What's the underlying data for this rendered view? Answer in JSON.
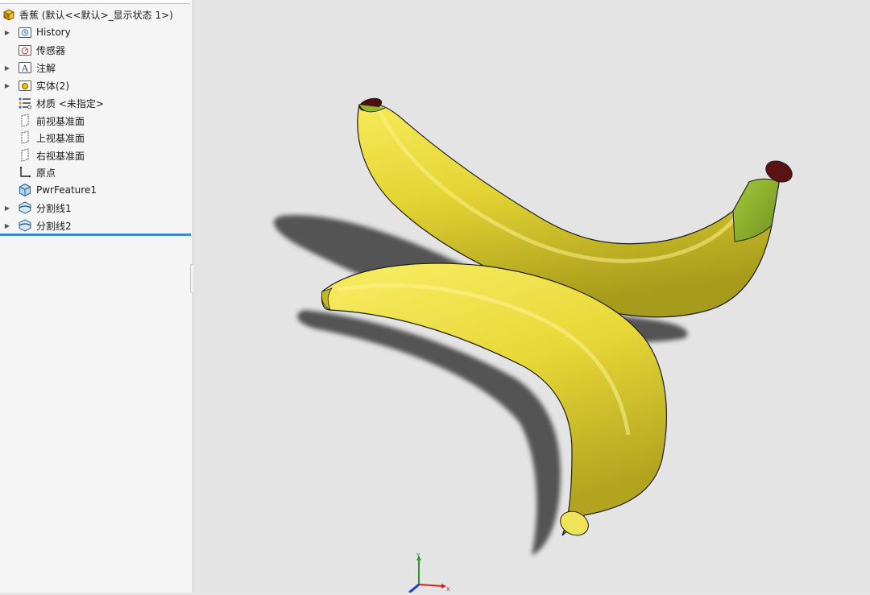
{
  "feature_tree": {
    "root": {
      "label": "香蕉 (默认<<默认>_显示状态 1>)",
      "icon": "part-icon"
    },
    "items": [
      {
        "label": "History",
        "icon": "history-folder-icon",
        "expandable": true
      },
      {
        "label": "传感器",
        "icon": "sensors-folder-icon",
        "expandable": false
      },
      {
        "label": "注解",
        "icon": "annotations-folder-icon",
        "expandable": true
      },
      {
        "label": "实体(2)",
        "icon": "solid-bodies-folder-icon",
        "expandable": true
      },
      {
        "label": "材质 <未指定>",
        "icon": "material-icon",
        "expandable": false
      },
      {
        "label": "前视基准面",
        "icon": "plane-icon",
        "expandable": false
      },
      {
        "label": "上视基准面",
        "icon": "plane-icon",
        "expandable": false
      },
      {
        "label": "右视基准面",
        "icon": "plane-icon",
        "expandable": false
      },
      {
        "label": "原点",
        "icon": "origin-icon",
        "expandable": false
      },
      {
        "label": "PwrFeature1",
        "icon": "power-surface-feature-icon",
        "expandable": false
      },
      {
        "label": "分割线1",
        "icon": "split-line-icon",
        "expandable": true
      },
      {
        "label": "分割线2",
        "icon": "split-line-icon",
        "expandable": true
      }
    ]
  },
  "triad": {
    "x_label": "X",
    "y_label": "Y",
    "z_label": "Z"
  },
  "colors": {
    "banana_yellow": "#e6d832",
    "banana_shadow": "#3d3d3d",
    "stem_green": "#8fb52a",
    "stem_tip": "#5a1212",
    "accent_bar": "#3c8ad0",
    "viewport_bg": "#e4e4e4"
  }
}
